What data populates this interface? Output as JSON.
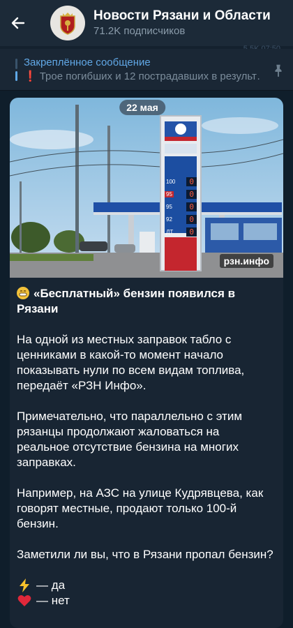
{
  "header": {
    "title": "Новости Рязани и Области",
    "subscribers": "71.2K подписчиков"
  },
  "background_hint": "5.5K 07:50",
  "pinned": {
    "label": "Закреплённое сообщение",
    "message": "Трое погибших и 12 пострадавших в результ…"
  },
  "post": {
    "date": "22 мая",
    "watermark": "рзн.инфо",
    "title": "«Бесплатный» бензин появился в Рязани",
    "paragraphs": [
      "На одной из местных заправок табло с ценниками в какой-то момент начало показывать нули по всем видам топлива, передаёт «РЗН Инфо».",
      "Примечательно, что параллельно с этим рязанцы продолжают жаловаться на реальное отсутствие бензина на многих заправках.",
      "Например, на АЗС на улице Кудрявцева, как говорят местные, продают только 100-й бензин.",
      "Заметили ли вы, что в Рязани пропал бензин?"
    ],
    "votes": [
      {
        "icon": "lightning-icon",
        "label": "— да"
      },
      {
        "icon": "heart-icon",
        "label": "— нет"
      }
    ],
    "sign_prices": [
      "100",
      "95",
      "95",
      "92",
      "ДТ"
    ],
    "sign_values": [
      "0",
      "0",
      "0",
      "0",
      "0"
    ]
  },
  "colors": {
    "header_bg": "#1c2a38",
    "chat_bg": "#0f1e2b",
    "bubble_bg": "#182533",
    "accent": "#61a8e6",
    "secondary_text": "#8a9baa"
  }
}
